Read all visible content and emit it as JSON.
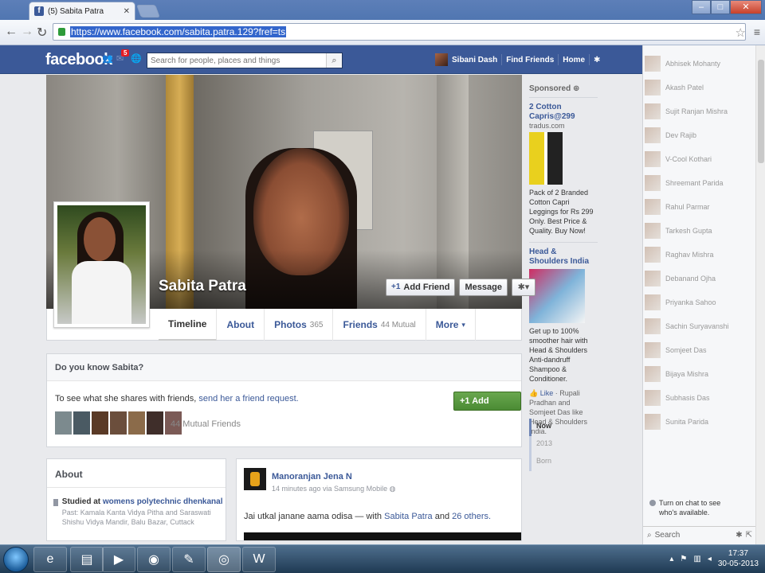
{
  "browser": {
    "tab_title": "(5) Sabita Patra",
    "tab_icon": "facebook-favicon",
    "url": "https://www.facebook.com/sabita.patra.129?fref=ts"
  },
  "fb_header": {
    "logo": "facebook",
    "notification_count": "5",
    "search_placeholder": "Search for people, places and things",
    "user_name": "Sibani Dash",
    "find_friends": "Find Friends",
    "home": "Home"
  },
  "profile": {
    "name": "Sabita Patra",
    "add_friend_label": "Add Friend",
    "message_label": "Message",
    "tabs": [
      {
        "label": "Timeline",
        "count": ""
      },
      {
        "label": "About",
        "count": ""
      },
      {
        "label": "Photos",
        "count": "365"
      },
      {
        "label": "Friends",
        "count": "44 Mutual"
      },
      {
        "label": "More",
        "count": ""
      }
    ]
  },
  "do_you_know": {
    "title": "Do you know Sabita?",
    "text_prefix": "To see what she shares with friends, ",
    "link": "send her a friend request.",
    "button": "Add Friend",
    "mutual_count": "44 Mutual Friends"
  },
  "about": {
    "title": "About",
    "studied_prefix": "Studied at ",
    "school": "womens polytechnic dhenkanal",
    "past": "Past: Kamala Kanta Vidya Pitha and Saraswati Shishu Vidya Mandir, Balu Bazar, Cuttack"
  },
  "post": {
    "author": "Manoranjan Jena N",
    "meta": "14 minutes ago via Samsung Mobile",
    "text_prefix": "Jai utkal janane aama odisa — with ",
    "tag1": "Sabita Patra",
    "tag_and": " and ",
    "tag2": "26 others."
  },
  "ads": {
    "heading": "Sponsored",
    "items": [
      {
        "title": "2 Cotton Capris@299",
        "domain": "tradus.com",
        "desc": "Pack of 2 Branded Cotton Capri Leggings for Rs 299 Only. Best Price & Quality. Buy Now!"
      },
      {
        "title": "Head & Shoulders India",
        "domain": "",
        "desc": "Get up to 100% smoother hair with Head & Shoulders Anti-dandruff Shampoo & Conditioner.",
        "like": "Like",
        "like_text": " · Rupali Pradhan and Somjeet Das like Head & Shoulders India."
      }
    ]
  },
  "timeline_years": [
    "Now",
    "2013",
    "Born"
  ],
  "chat": {
    "friends": [
      "Abhisek Mohanty",
      "Akash Patel",
      "Sujit Ranjan Mishra",
      "Dev Rajib",
      "V-Cool Kothari",
      "Shreemant Parida",
      "Rahul Parmar",
      "Tarkesh Gupta",
      "Raghav Mishra",
      "Debanand Ojha",
      "Priyanka Sahoo",
      "Sachin Suryavanshi",
      "Somjeet Das",
      "Bijaya Mishra",
      "Subhasis Das",
      "Sunita Parida"
    ],
    "turn_on": "Turn on chat to see who's available.",
    "search": "Search"
  },
  "taskbar": {
    "time": "17:37",
    "date": "30-05-2013"
  }
}
